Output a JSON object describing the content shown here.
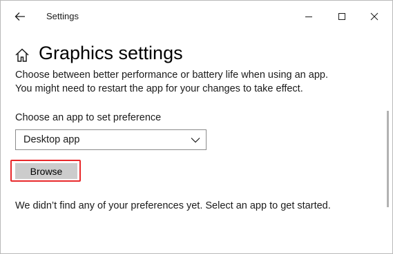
{
  "window": {
    "title": "Settings",
    "controls": {
      "minimize_icon": "minimize-icon",
      "maximize_icon": "maximize-icon",
      "close_icon": "close-icon"
    }
  },
  "header": {
    "back_icon": "arrow-left-icon",
    "home_icon": "home-icon",
    "title": "Graphics settings"
  },
  "description": {
    "line1": "Choose between better performance or battery life when using an app.",
    "line2": "You might need to restart the app for your changes to take effect."
  },
  "app_picker": {
    "label": "Choose an app to set preference",
    "selected": "Desktop app",
    "chevron_icon": "chevron-down-icon"
  },
  "browse": {
    "label": "Browse"
  },
  "status": {
    "message": "We didn’t find any of your preferences yet. Select an app to get started."
  },
  "colors": {
    "highlight": "#e8282a",
    "button_bg": "#cccccc",
    "scrollbar": "#b2b2b2"
  }
}
